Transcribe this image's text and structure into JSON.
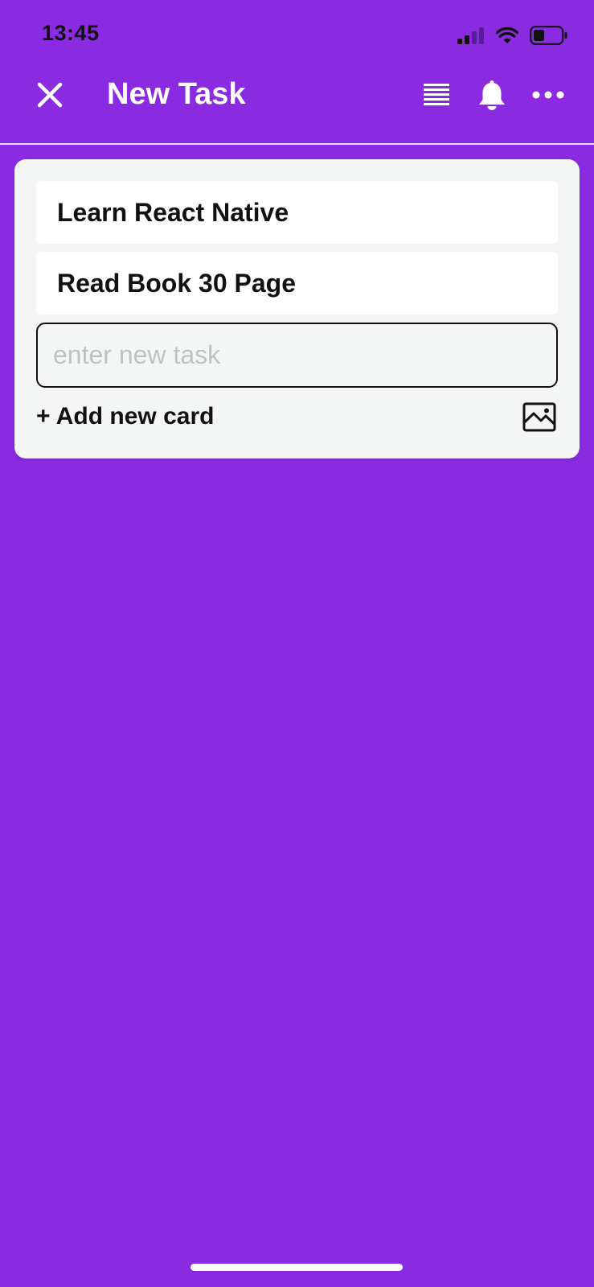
{
  "status_bar": {
    "time": "13:45",
    "icons": [
      "signal-icon",
      "wifi-icon",
      "battery-icon"
    ]
  },
  "header": {
    "title": "New Task",
    "icons": [
      "close-icon",
      "list-icon",
      "bell-icon",
      "more-icon"
    ]
  },
  "card": {
    "tasks": [
      {
        "label": "Learn React Native"
      },
      {
        "label": "Read Book 30 Page"
      }
    ],
    "input": {
      "value": "",
      "placeholder": "enter new task"
    },
    "add_card_label": "+ Add new card",
    "image_icon": "image-icon"
  },
  "colors": {
    "background": "#8A2BE2",
    "card": "#F4F6F6",
    "placeholder": "#BFC2C4"
  }
}
